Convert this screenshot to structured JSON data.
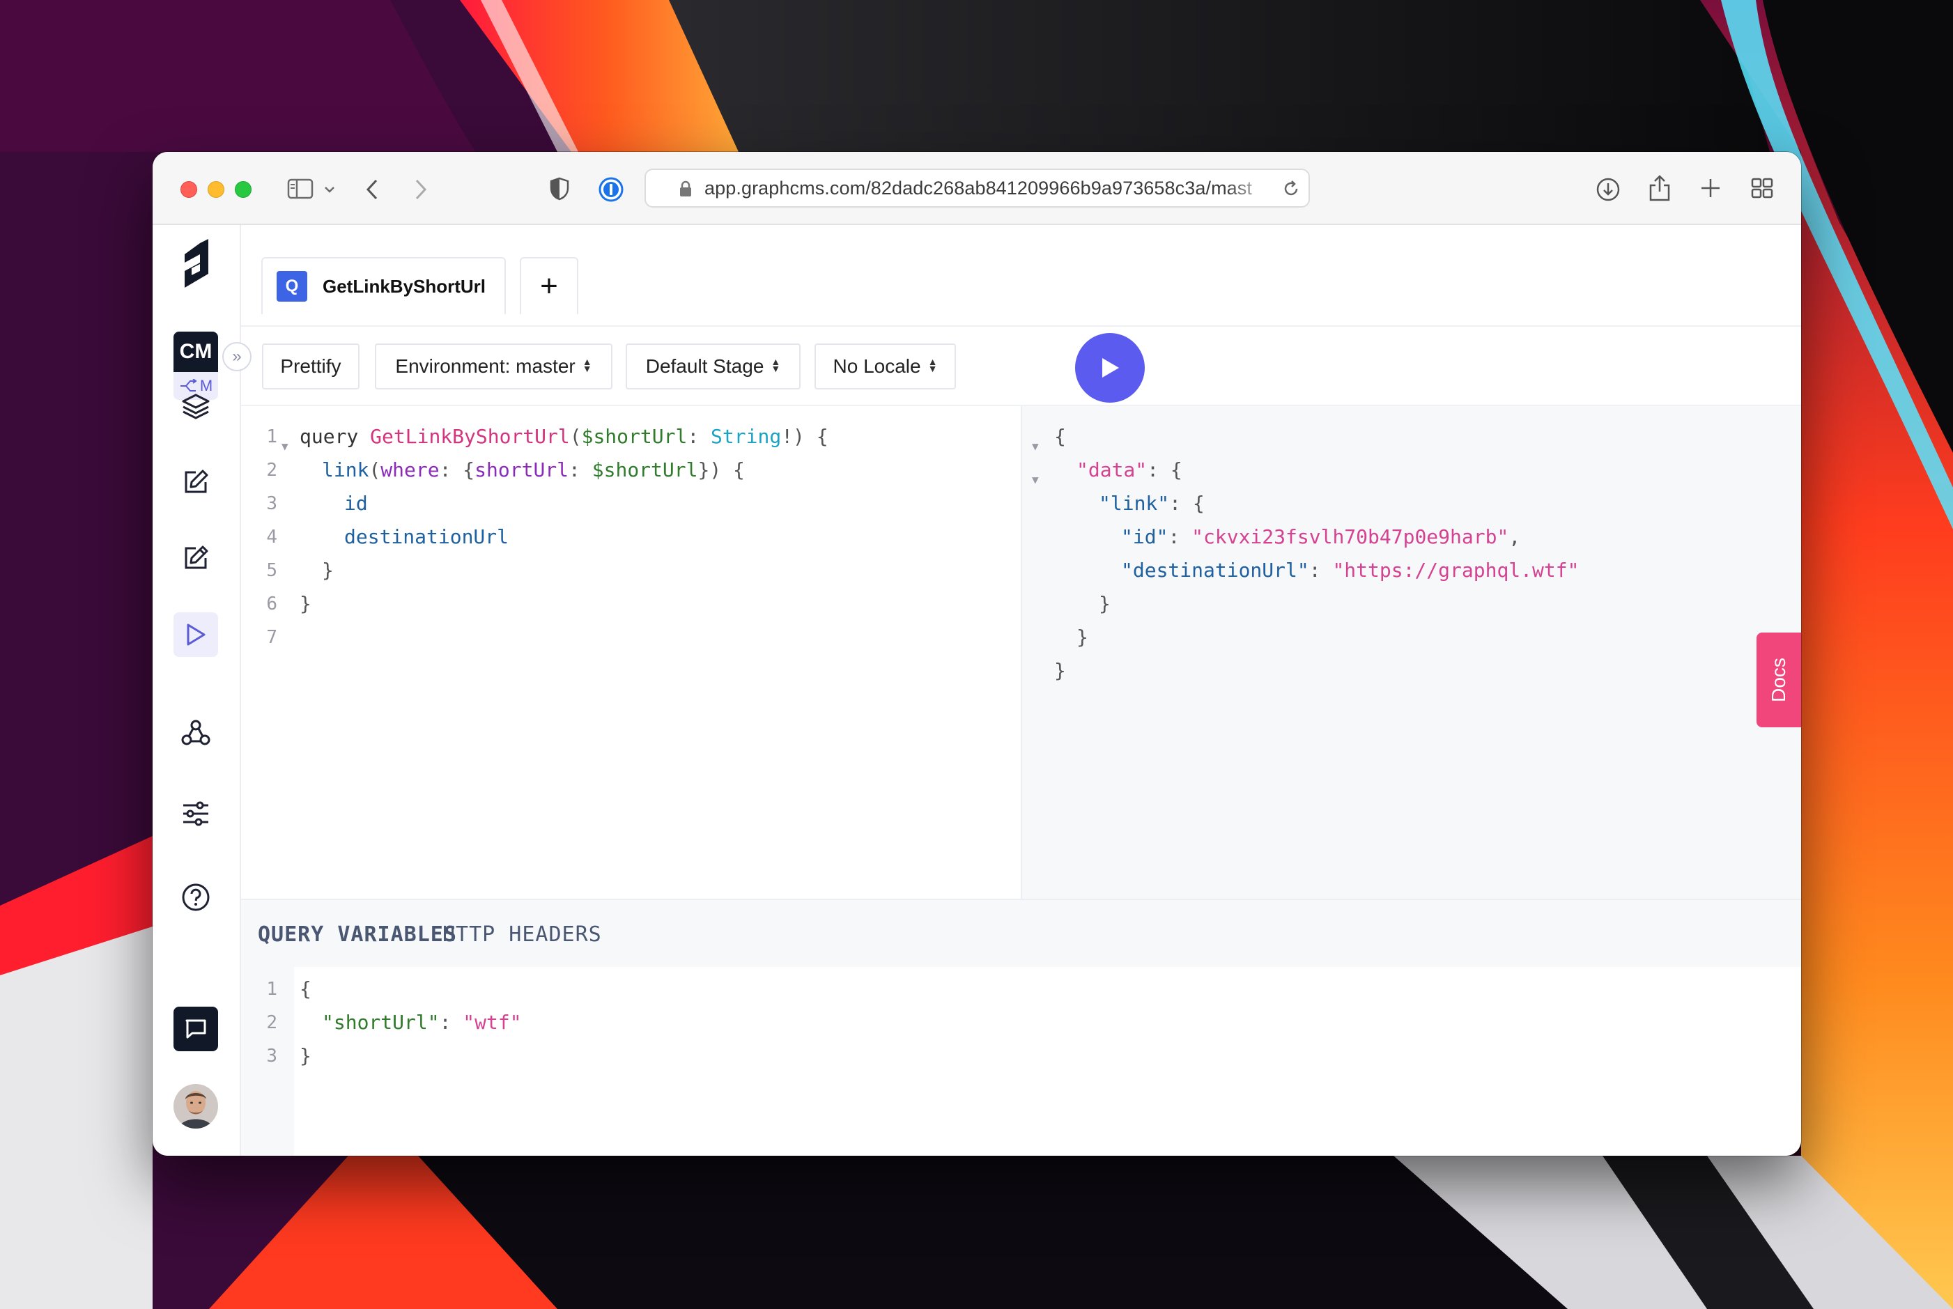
{
  "browser": {
    "url": "app.graphcms.com/82dadc268ab841209966b9a973658c3a/mast",
    "icons": [
      "sidebar-toggle-icon",
      "chevron-down-icon",
      "back-arrow-icon",
      "forward-arrow-icon",
      "shield-icon",
      "password-manager-icon",
      "lock-icon",
      "reload-icon",
      "download-icon",
      "share-icon",
      "new-tab-icon",
      "tab-overview-icon"
    ]
  },
  "sidebar": {
    "project_badge": "CM",
    "project_sub": "M",
    "icons": [
      "graphcms-logo-icon",
      "schema-layers-icon",
      "content-edit-icon",
      "content-edit-alt-icon",
      "api-playground-icon",
      "webhooks-icon",
      "settings-sliders-icon",
      "help-icon",
      "chat-icon",
      "user-avatar"
    ]
  },
  "tabs": {
    "active": {
      "badge": "Q",
      "label": "GetLinkByShortUrl"
    },
    "add_label": "+"
  },
  "actions": {
    "prettify": "Prettify",
    "environment": "Environment: master",
    "stage": "Default Stage",
    "locale": "No Locale"
  },
  "query": {
    "line_numbers": [
      "1",
      "2",
      "3",
      "4",
      "5",
      "6",
      "7"
    ],
    "l1": {
      "kw": "query ",
      "name": "GetLinkByShortUrl",
      "p1": "(",
      "var": "$shortUrl",
      "p2": ": ",
      "type": "String",
      "p3": "!) {"
    },
    "l2": {
      "field": "link",
      "p1": "(",
      "arg": "where",
      "p2": ": {",
      "arg2": "shortUrl",
      "p3": ": ",
      "var": "$shortUrl",
      "p4": "}) {"
    },
    "l3": "id",
    "l4": "destinationUrl",
    "l5": "}",
    "l6": "}"
  },
  "result": {
    "open": "{",
    "data_key": "\"data\"",
    "link_key": "\"link\"",
    "id_key": "\"id\"",
    "id_value": "\"ckvxi23fsvlh70b47p0e9harb\"",
    "dest_key": "\"destinationUrl\"",
    "dest_value": "\"https://graphql.wtf\"",
    "colon_brace": ": {",
    "colon": ": ",
    "comma": ",",
    "close": "}"
  },
  "docs_label": "Docs",
  "variables": {
    "tab_query_variables": "QUERY VARIABLES",
    "tab_http_headers": "HTTP HEADERS",
    "line_numbers": [
      "1",
      "2",
      "3"
    ],
    "open": "{",
    "key": "\"shortUrl\"",
    "colon": ": ",
    "value": "\"wtf\"",
    "close": "}"
  },
  "colors": {
    "accent": "#5b5bf0",
    "docs": "#f0467c",
    "tab_badge": "#3e64e6"
  }
}
